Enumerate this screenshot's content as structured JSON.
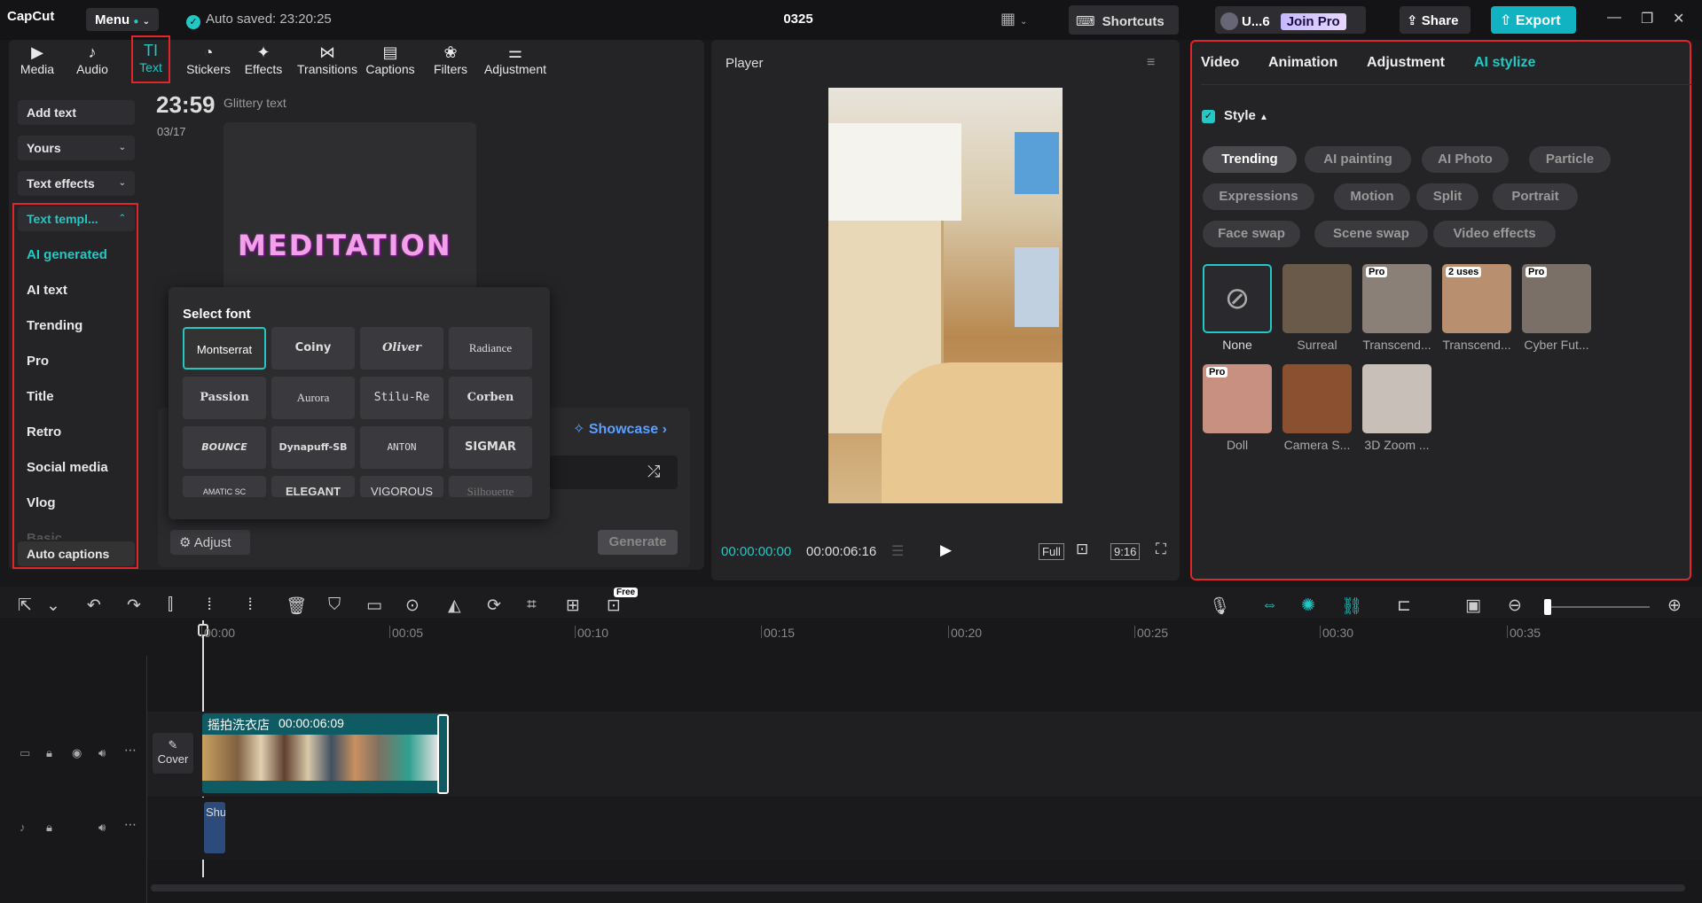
{
  "app": {
    "name": "CapCut",
    "menu_label": "Menu",
    "autosave": "Auto saved: 23:20:25",
    "project_title": "0325",
    "shortcuts_label": "Shortcuts",
    "user_label": "U...6",
    "join_pro_label": "Join Pro",
    "share_label": "Share",
    "export_label": "Export"
  },
  "toolbar": {
    "tabs": [
      {
        "label": "Media",
        "icon": "media-icon"
      },
      {
        "label": "Audio",
        "icon": "audio-icon"
      },
      {
        "label": "Text",
        "icon": "text-icon",
        "active": true
      },
      {
        "label": "Stickers",
        "icon": "stickers-icon"
      },
      {
        "label": "Effects",
        "icon": "effects-icon"
      },
      {
        "label": "Transitions",
        "icon": "transitions-icon"
      },
      {
        "label": "Captions",
        "icon": "captions-icon"
      },
      {
        "label": "Filters",
        "icon": "filters-icon"
      },
      {
        "label": "Adjustment",
        "icon": "adjustment-icon"
      }
    ]
  },
  "left_sidebar": {
    "add_text": "Add text",
    "yours": "Yours",
    "text_effects": "Text effects",
    "text_templates": "Text templ...",
    "template_items": [
      "AI generated",
      "AI text",
      "Trending",
      "Pro",
      "Title",
      "Retro",
      "Social media",
      "Vlog",
      "Basic"
    ],
    "auto_captions": "Auto captions"
  },
  "content": {
    "time": "23:59",
    "time_caption": "Glittery text",
    "date": "03/17",
    "preview_text": "MEDITATION",
    "showcase": "Showcase",
    "adjust": "Adjust",
    "generate": "Generate"
  },
  "font_popup": {
    "title": "Select font",
    "fonts": [
      "Montserrat",
      "Coiny",
      "Oliver",
      "Radiance",
      "Passion",
      "Aurora",
      "Stilu-Re",
      "Corben",
      "BOUNCE",
      "Dynapuff-SB",
      "ANTON",
      "SIGMAR",
      "AMATIC SC",
      "ELEGANT",
      "VIGOROUS",
      "Silhouette"
    ],
    "selected": "Montserrat"
  },
  "player": {
    "title": "Player",
    "time_current": "00:00:00:00",
    "time_total": "00:00:06:16",
    "full_label": "Full",
    "ratio_label": "9:16"
  },
  "props": {
    "tabs": [
      "Video",
      "Animation",
      "Adjustment",
      "AI stylize"
    ],
    "active_tab": "AI stylize",
    "style_label": "Style",
    "chips_row1": [
      "Trending",
      "AI painting",
      "AI Photo",
      "Particle"
    ],
    "chips_row2": [
      "Expressions",
      "Motion",
      "Split",
      "Portrait"
    ],
    "chips_row3": [
      "Face swap",
      "Scene swap",
      "Video effects"
    ],
    "styles": [
      {
        "label": "None",
        "badge": "",
        "color": "#2a2a2e"
      },
      {
        "label": "Surreal",
        "badge": "",
        "color": "#6a5a4a"
      },
      {
        "label": "Transcend...",
        "badge": "Pro",
        "color": "#8a8078"
      },
      {
        "label": "Transcend...",
        "badge": "2 uses",
        "color": "#b89070"
      },
      {
        "label": "Cyber Fut...",
        "badge": "Pro",
        "color": "#7a7068"
      },
      {
        "label": "Doll",
        "badge": "Pro",
        "color": "#c89080"
      },
      {
        "label": "Camera S...",
        "badge": "",
        "color": "#8a5030"
      },
      {
        "label": "3D Zoom ...",
        "badge": "",
        "color": "#c8c0b8"
      }
    ]
  },
  "timeline": {
    "ruler": [
      "00:00",
      "00:05",
      "00:10",
      "00:15",
      "00:20",
      "00:25",
      "00:30",
      "00:35"
    ],
    "free_badge": "Free",
    "clip_name": "摇拍洗衣店",
    "clip_duration": "00:00:06:09",
    "cover_label": "Cover",
    "audio_clip": "Shu"
  },
  "colors": {
    "accent": "#21c8c4",
    "highlight_border": "#e0262b",
    "export_bg": "#11b3c2"
  }
}
